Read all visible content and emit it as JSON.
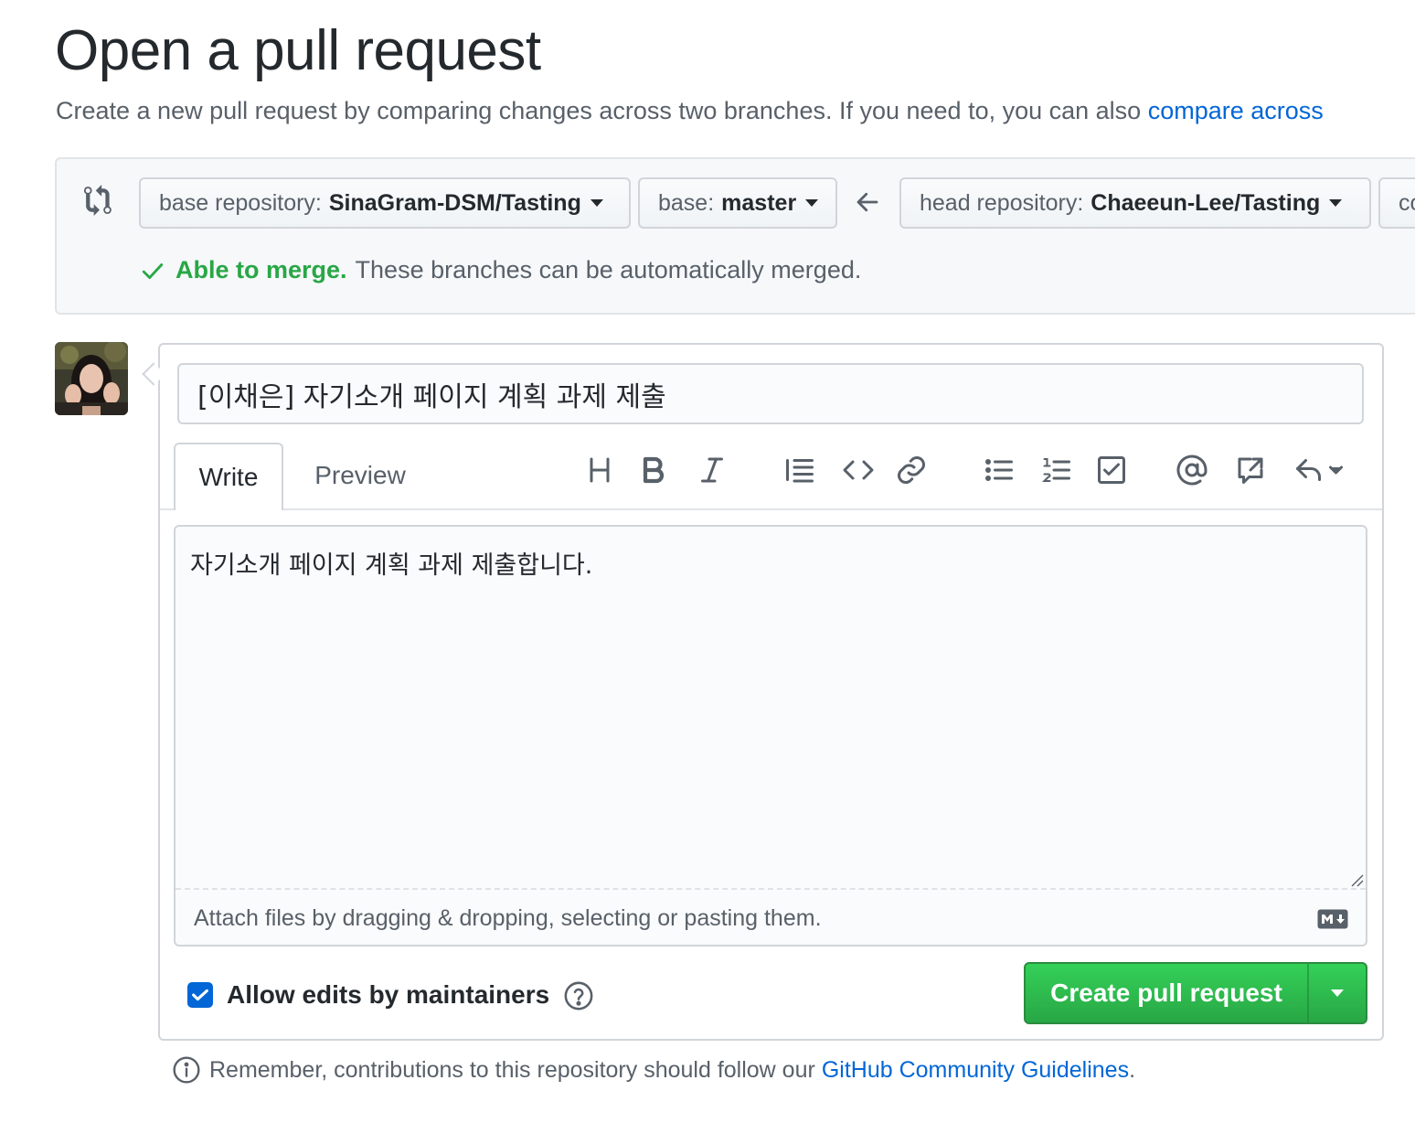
{
  "page": {
    "title": "Open a pull request",
    "subtitle_text": "Create a new pull request by comparing changes across two branches. If you need to, you can also",
    "subtitle_link": "compare across"
  },
  "compare": {
    "base_repo_label": "base repository:",
    "base_repo_value": "SinaGram-DSM/Tasting",
    "base_branch_label": "base:",
    "base_branch_value": "master",
    "head_repo_label": "head repository:",
    "head_repo_value": "Chaeeun-Lee/Tasting",
    "compare_label": "co",
    "merge_ok": "Able to merge.",
    "merge_desc": "These branches can be automatically merged."
  },
  "form": {
    "title_value": "[이채은] 자기소개 페이지 계획 과제 제출",
    "tabs": [
      "Write",
      "Preview"
    ],
    "toolbar_icons": [
      "header-icon",
      "bold-icon",
      "italic-icon",
      "quote-icon",
      "code-icon",
      "link-icon",
      "unordered-list-icon",
      "ordered-list-icon",
      "task-list-icon",
      "mention-icon",
      "reference-icon",
      "reply-icon"
    ],
    "body_value": "자기소개 페이지 계획 과제 제출합니다.",
    "attach_text": "Attach files by dragging & dropping, selecting or pasting them.",
    "allow_edits_label": "Allow edits by maintainers",
    "allow_edits_checked": true,
    "create_button": "Create pull request"
  },
  "footer": {
    "note_text": "Remember, contributions to this repository should follow our",
    "note_link": "GitHub Community Guidelines",
    "note_end": "."
  },
  "colors": {
    "link": "#0366d6",
    "success": "#28a745",
    "primary_button": "#2ea44f"
  }
}
